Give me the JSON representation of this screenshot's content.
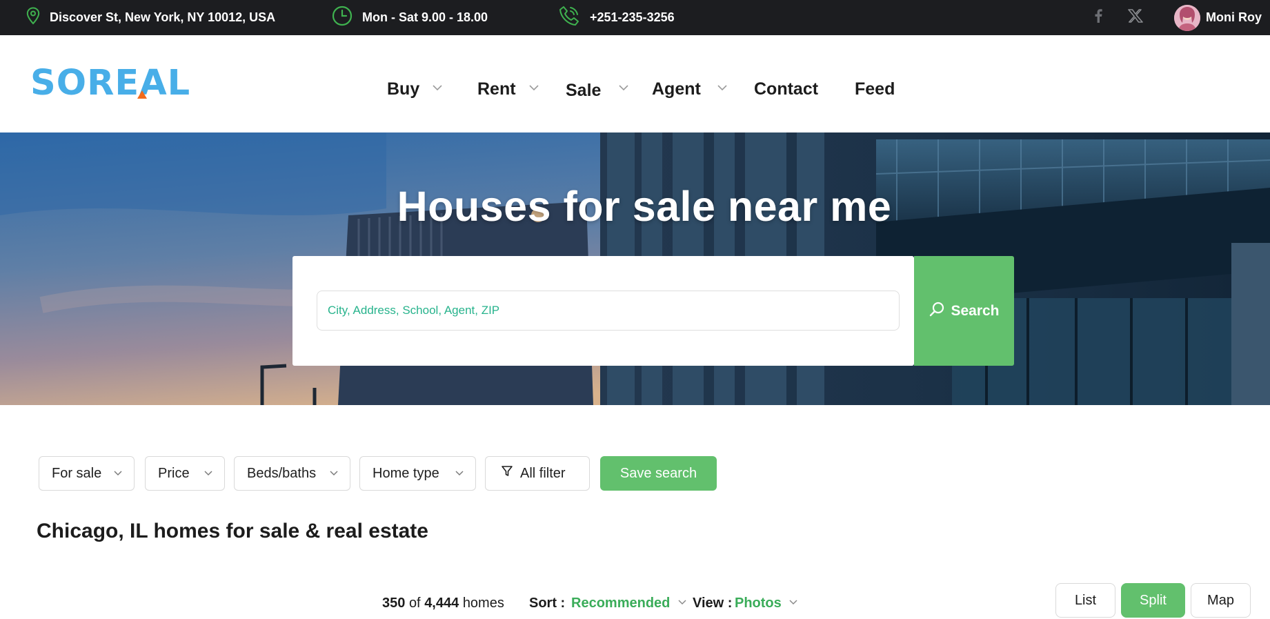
{
  "topbar": {
    "address": "Discover St, New York, NY 10012, USA",
    "hours": "Mon - Sat 9.00 - 18.00",
    "phone": "+251-235-3256",
    "social": [
      "facebook-icon",
      "x-icon"
    ],
    "user_name": "Moni Roy"
  },
  "header": {
    "logo": "SOREAL",
    "nav": [
      {
        "label": "Buy",
        "has_dropdown": true
      },
      {
        "label": "Rent",
        "has_dropdown": true
      },
      {
        "label": "Sale",
        "has_dropdown": true
      },
      {
        "label": "Agent",
        "has_dropdown": true
      },
      {
        "label": "Contact",
        "has_dropdown": false
      },
      {
        "label": "Feed",
        "has_dropdown": false
      }
    ]
  },
  "hero": {
    "title": "Houses for sale near me",
    "search_placeholder": "City, Address, School, Agent, ZIP",
    "search_button": "Search"
  },
  "filters": {
    "items": [
      "For sale",
      "Price",
      "Beds/baths",
      "Home type"
    ],
    "all_filter": "All filter",
    "save_search": "Save search"
  },
  "results": {
    "title": "Chicago, IL homes for sale & real estate",
    "shown": "350",
    "of_label": "of",
    "total": "4,444",
    "unit": "homes",
    "sort_label": "Sort :",
    "sort_value": "Recommended",
    "view_label": "View :",
    "view_value": "Photos",
    "view_modes": [
      "List",
      "Split",
      "Map"
    ],
    "active_mode": "Split"
  },
  "colors": {
    "accent": "#62c06d",
    "logo": "#48aee8",
    "topbar": "#1c1d20",
    "placeholder": "#27b38c"
  }
}
